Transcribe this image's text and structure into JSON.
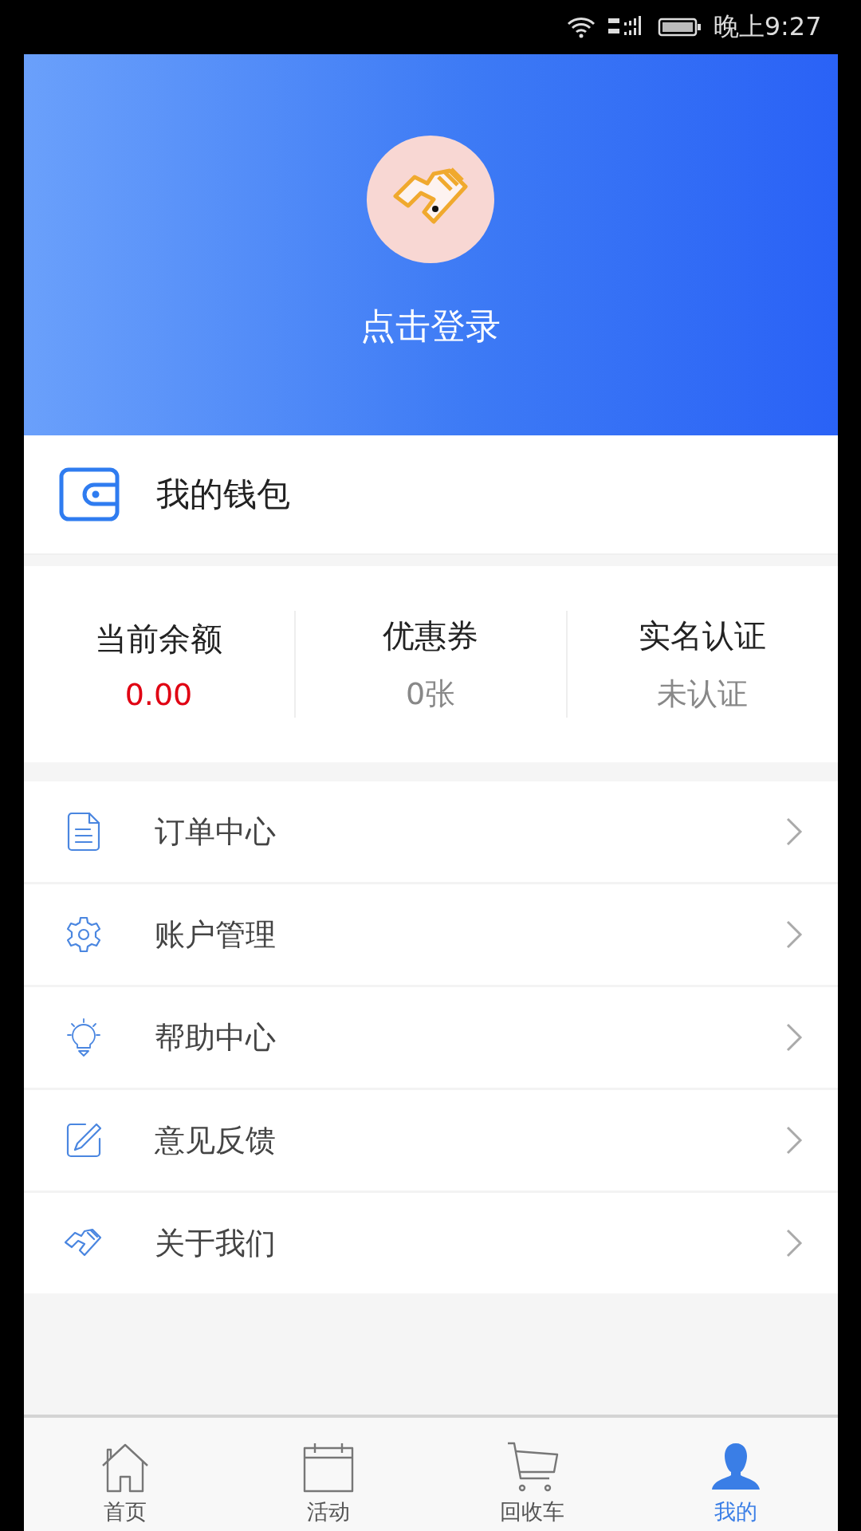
{
  "status_bar": {
    "time": "晚上9:27"
  },
  "profile": {
    "login": "点击登录"
  },
  "wallet": {
    "title": "我的钱包"
  },
  "stats": [
    {
      "label": "当前余额",
      "value": "0.00",
      "highlight": true
    },
    {
      "label": "优惠券",
      "value": "0张",
      "highlight": false
    },
    {
      "label": "实名认证",
      "value": "未认证",
      "highlight": false
    }
  ],
  "menu": [
    {
      "label": "订单中心"
    },
    {
      "label": "账户管理"
    },
    {
      "label": "帮助中心"
    },
    {
      "label": "意见反馈"
    },
    {
      "label": "关于我们"
    }
  ],
  "tabs": [
    {
      "label": "首页",
      "selected": false
    },
    {
      "label": "活动",
      "selected": false
    },
    {
      "label": "回收车",
      "selected": false
    },
    {
      "label": "我的",
      "selected": true
    }
  ]
}
